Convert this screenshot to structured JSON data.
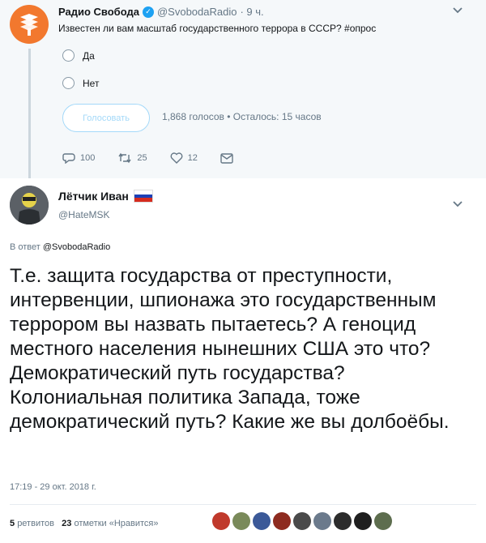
{
  "parent_tweet": {
    "author_name": "Радио Свобода",
    "handle": "@SvobodaRadio",
    "time": "· 9 ч.",
    "text": "Известен ли вам масштаб государственного террора в СССР? #опрос",
    "poll": {
      "options": [
        "Да",
        "Нет"
      ],
      "vote_label": "Голосовать",
      "meta": "1,868 голосов • Осталось: 15 часов"
    },
    "actions": {
      "replies": "100",
      "retweets": "25",
      "likes": "12"
    }
  },
  "reply_tweet": {
    "author_name": "Лётчик Иван",
    "handle": "@HateMSK",
    "in_reply_prefix": "В ответ",
    "in_reply_mention": "@SvobodaRadio",
    "text": "Т.е. защита государства от преступности, интервенции, шпионажа это государственным террором вы назвать пытаетесь? А геноцид местного населения нынешних США это что? Демократический путь государства? Колониальная политика Запада, тоже демократический путь? Какие же вы долбоёбы.",
    "timestamp": "17:19 - 29 окт. 2018 г.",
    "retweets_count": "5",
    "retweets_label": "ретвитов",
    "likes_count": "23",
    "likes_label": "отметки «Нравится»"
  },
  "colors": {
    "brand_orange": "#f2782e",
    "twitter_blue": "#1da1f2",
    "muted": "#657786"
  }
}
